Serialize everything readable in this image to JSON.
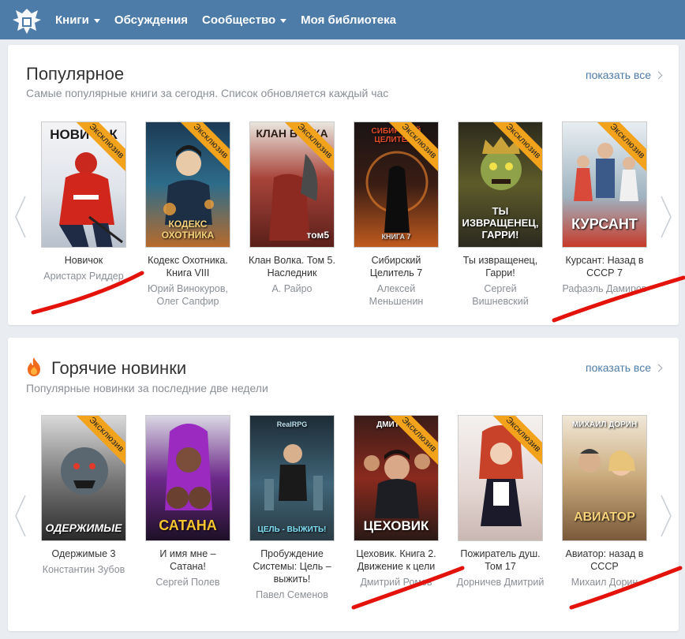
{
  "nav": {
    "items": [
      {
        "label": "Книги",
        "has_dropdown": true
      },
      {
        "label": "Обсуждения",
        "has_dropdown": false
      },
      {
        "label": "Сообщество",
        "has_dropdown": true
      },
      {
        "label": "Моя библиотека",
        "has_dropdown": false
      }
    ]
  },
  "popular": {
    "title": "Популярное",
    "subtitle": "Самые популярные книги за сегодня. Список обновляется каждый час",
    "show_all": "показать все",
    "books": [
      {
        "title": "Новичок",
        "author": "Аристарх Риддер",
        "badge": "Эксклюзив",
        "cover_text_top": "НОВИЧОК",
        "cover_text_bottom": ""
      },
      {
        "title": "Кодекс Охотника. Книга VIII",
        "author": "Юрий Винокуров, Олег Сапфир",
        "badge": "Эксклюзив",
        "cover_text_top": "",
        "cover_text_bottom": "КОДЕКС ОХОТНИКА"
      },
      {
        "title": "Клан Волка. Том 5. Наследник",
        "author": "А. Райро",
        "badge": "Эксклюзив",
        "cover_text_top": "КЛАН ВОЛКА",
        "cover_text_bottom": "том5"
      },
      {
        "title": "Сибирский Целитель 7",
        "author": "Алексей Меньшенин",
        "badge": "Эксклюзив",
        "cover_text_top": "СИБИРСКИЙ ЦЕЛИТЕЛЬ",
        "cover_text_bottom": "КНИГА 7"
      },
      {
        "title": "Ты извращенец, Гарри!",
        "author": "Сергей Вишневский",
        "badge": "Эксклюзив",
        "cover_text_top": "",
        "cover_text_bottom": "ТЫ ИЗВРАЩЕНЕЦ, ГАРРИ!"
      },
      {
        "title": "Курсант: Назад в СССР 7",
        "author": "Рафаэль Дамиров",
        "badge": "Эксклюзив",
        "cover_text_top": "",
        "cover_text_bottom": "КУРСАНТ"
      }
    ]
  },
  "hot": {
    "title": "Горячие новинки",
    "subtitle": "Популярные новинки за последние две недели",
    "show_all": "показать все",
    "books": [
      {
        "title": "Одержимые 3",
        "author": "Константин Зубов",
        "badge": "Эксклюзив",
        "cover_text_top": "",
        "cover_text_bottom": "ОДЕРЖИМЫЕ"
      },
      {
        "title": "И имя мне – Сатана!",
        "author": "Сергей Полев",
        "badge": "",
        "cover_text_top": "",
        "cover_text_bottom": "САТАНА"
      },
      {
        "title": "Пробуждение Системы: Цель – выжить!",
        "author": "Павел Семенов",
        "badge": "",
        "cover_text_top": "RealRPG",
        "cover_text_bottom": "ЦЕЛЬ - ВЫЖИТЬ!"
      },
      {
        "title": "Цеховик. Книга 2. Движение к цели",
        "author": "Дмитрий Ромов",
        "badge": "Эксклюзив",
        "cover_text_top": "ДМИТРИЙ",
        "cover_text_bottom": "ЦЕХОВИК"
      },
      {
        "title": "Пожиратель душ. Том 17",
        "author": "Дорничев Дмитрий",
        "badge": "Эксклюзив",
        "cover_text_top": "",
        "cover_text_bottom": ""
      },
      {
        "title": "Авиатор: назад в СССР",
        "author": "Михаил Дорин",
        "badge": "",
        "cover_text_top": "МИХАИЛ ДОРИН",
        "cover_text_bottom": "АВИАТОР"
      }
    ]
  },
  "colors": {
    "header_bg": "#4d7ca9",
    "link": "#4d7ca9",
    "badge": "#f2a21b",
    "scribble": "#e3120b"
  }
}
